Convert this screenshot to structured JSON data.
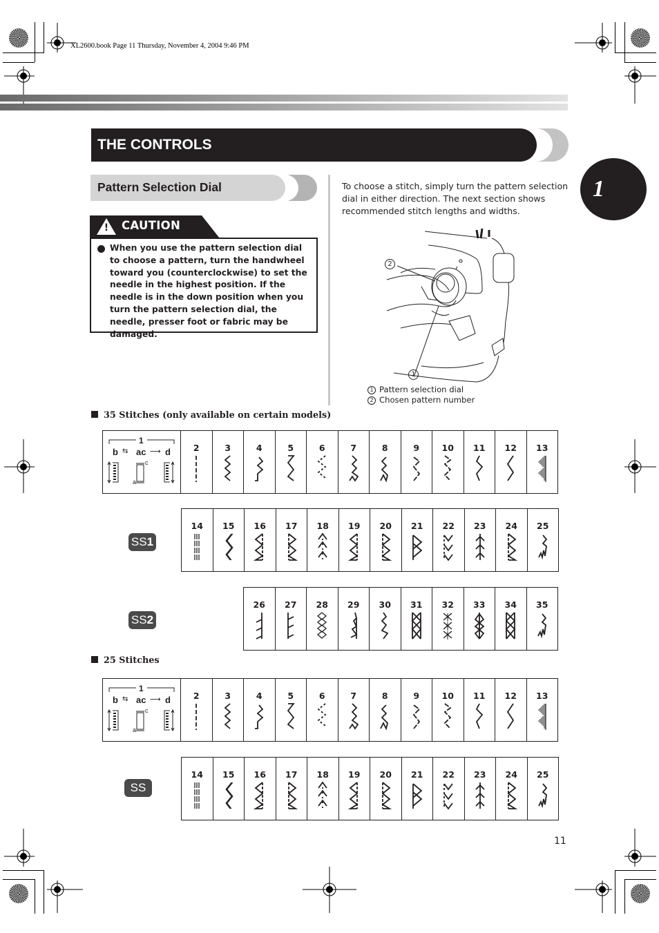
{
  "print_header": "XL2600.book  Page 11  Thursday, November 4, 2004  9:46 PM",
  "section_title": "THE CONTROLS",
  "chapter_number": "1",
  "subsection_title": "Pattern Selection Dial",
  "caution": {
    "label": "CAUTION",
    "icon": "warning-triangle-icon",
    "text": "When you use the pattern selection dial to choose a pattern, turn the handwheel toward you (counterclockwise) to set the needle in the highest position. If the needle is in the down position when you turn the pattern selection dial, the needle, presser foot or fabric may be  damaged."
  },
  "intro_text": "To choose a stitch, simply turn the pattern selection dial in either direction. The next section shows recommended stitch lengths and widths.",
  "illustration": {
    "callout_1": "1",
    "callout_2": "2",
    "legend": [
      {
        "num": "1",
        "label": "Pattern selection dial"
      },
      {
        "num": "2",
        "label": "Chosen pattern number"
      }
    ]
  },
  "stitch_sets": [
    {
      "heading": "35 Stitches (only available on certain models)",
      "rows": [
        {
          "badge": "",
          "first_cell": {
            "number": "1",
            "labels": [
              "b",
              "ac",
              "d"
            ],
            "sub_a": "a",
            "sub_c": "c"
          },
          "stitches": [
            {
              "n": "2",
              "icon": "straight"
            },
            {
              "n": "3",
              "icon": "zigzag"
            },
            {
              "n": "4",
              "icon": "zig4"
            },
            {
              "n": "5",
              "icon": "zig5"
            },
            {
              "n": "6",
              "icon": "dotzig"
            },
            {
              "n": "7",
              "icon": "multizig"
            },
            {
              "n": "8",
              "icon": "multizig2"
            },
            {
              "n": "9",
              "icon": "zig9"
            },
            {
              "n": "10",
              "icon": "zig10"
            },
            {
              "n": "11",
              "icon": "zig11"
            },
            {
              "n": "12",
              "icon": "zig12"
            },
            {
              "n": "13",
              "icon": "satin"
            }
          ]
        },
        {
          "badge": "SS",
          "badge_num": "1",
          "stitches": [
            {
              "n": "14",
              "icon": "triple"
            },
            {
              "n": "15",
              "icon": "triplezig"
            },
            {
              "n": "16",
              "icon": "blind1"
            },
            {
              "n": "17",
              "icon": "blind2"
            },
            {
              "n": "18",
              "icon": "feather"
            },
            {
              "n": "19",
              "icon": "blind1"
            },
            {
              "n": "20",
              "icon": "blind2"
            },
            {
              "n": "21",
              "icon": "herring"
            },
            {
              "n": "22",
              "icon": "chevron"
            },
            {
              "n": "23",
              "icon": "feather2"
            },
            {
              "n": "24",
              "icon": "blind2"
            },
            {
              "n": "25",
              "icon": "shell"
            }
          ]
        },
        {
          "badge": "SS",
          "badge_num": "2",
          "stitches": [
            {
              "n": "26",
              "icon": "e26"
            },
            {
              "n": "27",
              "icon": "e27"
            },
            {
              "n": "28",
              "icon": "cross"
            },
            {
              "n": "29",
              "icon": "e29"
            },
            {
              "n": "30",
              "icon": "e30"
            },
            {
              "n": "31",
              "icon": "cross2"
            },
            {
              "n": "32",
              "icon": "cross3"
            },
            {
              "n": "33",
              "icon": "cross4"
            },
            {
              "n": "34",
              "icon": "cross2"
            },
            {
              "n": "35",
              "icon": "shell"
            }
          ]
        }
      ]
    },
    {
      "heading": "25 Stitches",
      "rows": [
        {
          "badge": "",
          "first_cell": {
            "number": "1",
            "labels": [
              "b",
              "ac",
              "d"
            ],
            "sub_a": "a",
            "sub_c": "c"
          },
          "stitches": [
            {
              "n": "2",
              "icon": "straight"
            },
            {
              "n": "3",
              "icon": "zigzag"
            },
            {
              "n": "4",
              "icon": "zig4"
            },
            {
              "n": "5",
              "icon": "zig5"
            },
            {
              "n": "6",
              "icon": "dotzig"
            },
            {
              "n": "7",
              "icon": "multizig"
            },
            {
              "n": "8",
              "icon": "multizig2"
            },
            {
              "n": "9",
              "icon": "zig9"
            },
            {
              "n": "10",
              "icon": "zig10"
            },
            {
              "n": "11",
              "icon": "zig11"
            },
            {
              "n": "12",
              "icon": "zig12"
            },
            {
              "n": "13",
              "icon": "satin"
            }
          ]
        },
        {
          "badge": "SS",
          "badge_num": "",
          "stitches": [
            {
              "n": "14",
              "icon": "triple"
            },
            {
              "n": "15",
              "icon": "triplezig"
            },
            {
              "n": "16",
              "icon": "blind1"
            },
            {
              "n": "17",
              "icon": "blind2"
            },
            {
              "n": "18",
              "icon": "feather"
            },
            {
              "n": "19",
              "icon": "blind1"
            },
            {
              "n": "20",
              "icon": "blind2"
            },
            {
              "n": "21",
              "icon": "herring"
            },
            {
              "n": "22",
              "icon": "chevron"
            },
            {
              "n": "23",
              "icon": "feather2"
            },
            {
              "n": "24",
              "icon": "blind2"
            },
            {
              "n": "25",
              "icon": "shell"
            }
          ]
        }
      ]
    }
  ],
  "page_number": "11"
}
